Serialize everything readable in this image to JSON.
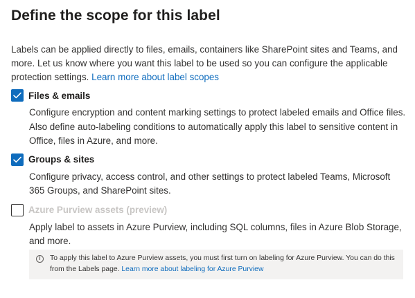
{
  "title": "Define the scope for this label",
  "intro": {
    "text": "Labels can be applied directly to files, emails, containers like SharePoint sites and Teams, and more. Let us know where you want this label to be used so you can configure the applicable protection settings. ",
    "link": "Learn more about label scopes"
  },
  "options": [
    {
      "label": "Files & emails",
      "checked": true,
      "disabled": false,
      "description": "Configure encryption and content marking settings to protect labeled emails and Office files. Also define auto-labeling conditions to automatically apply this label to sensitive content in Office, files in Azure, and more."
    },
    {
      "label": "Groups & sites",
      "checked": true,
      "disabled": false,
      "description": "Configure privacy, access control, and other settings to protect labeled Teams, Microsoft 365 Groups, and SharePoint sites."
    },
    {
      "label": "Azure Purview assets (preview)",
      "checked": false,
      "disabled": true,
      "description": "Apply label to assets in Azure Purview, including SQL columns, files in Azure Blob Storage, and more."
    }
  ],
  "notice": {
    "icon": "info-icon",
    "text": "To apply this label to Azure Purview assets, you must first turn on labeling for Azure Purview. You can do this from the Labels page. ",
    "link": "Learn more about labeling for Azure Purview"
  },
  "colors": {
    "accent": "#0f6cbd",
    "notice_bg": "#f3f2f1",
    "disabled_text": "#c8c6c4"
  }
}
